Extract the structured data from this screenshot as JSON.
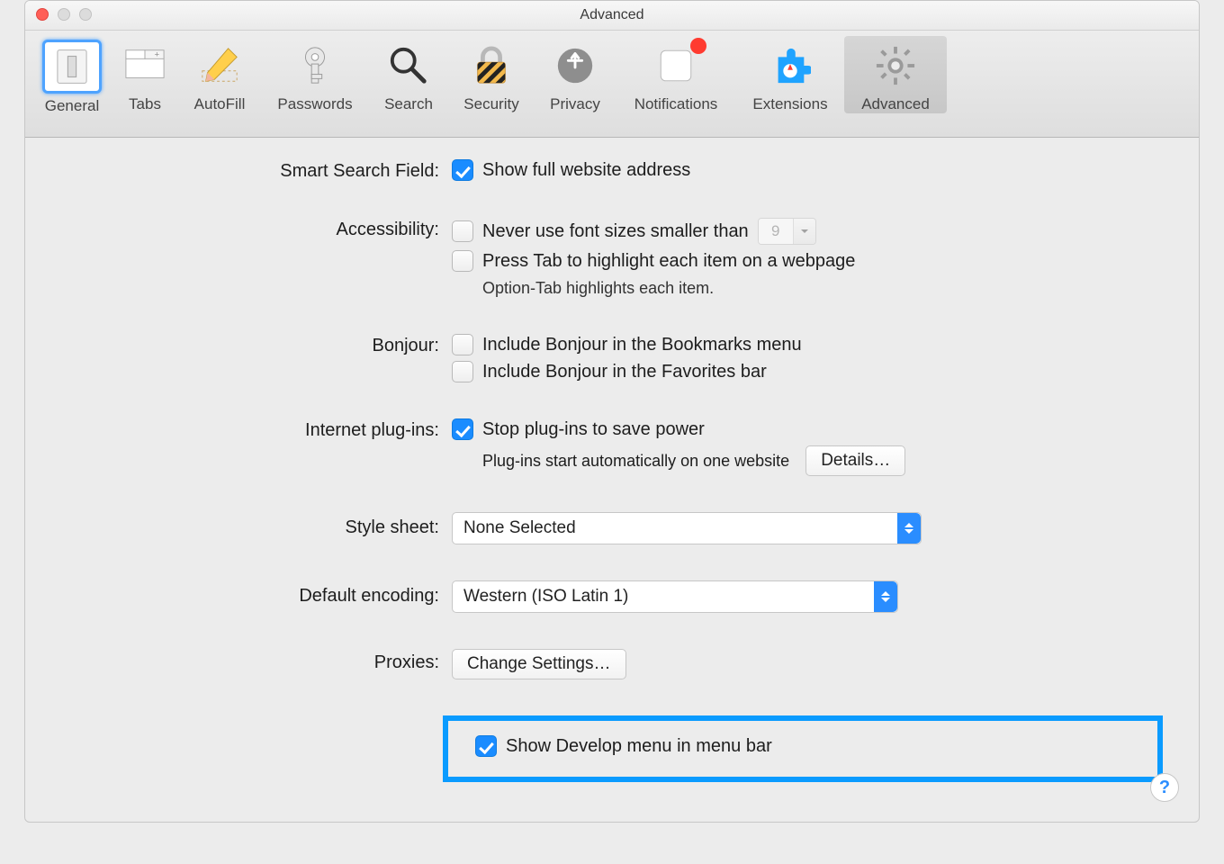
{
  "window": {
    "title": "Advanced"
  },
  "toolbar": {
    "items": [
      {
        "label": "General"
      },
      {
        "label": "Tabs"
      },
      {
        "label": "AutoFill"
      },
      {
        "label": "Passwords"
      },
      {
        "label": "Search"
      },
      {
        "label": "Security"
      },
      {
        "label": "Privacy"
      },
      {
        "label": "Notifications"
      },
      {
        "label": "Extensions"
      },
      {
        "label": "Advanced"
      }
    ]
  },
  "sections": {
    "smartSearch": {
      "label": "Smart Search Field:",
      "showFull": "Show full website address"
    },
    "accessibility": {
      "label": "Accessibility:",
      "neverSmaller": "Never use font sizes smaller than",
      "fontSize": "9",
      "pressTab": "Press Tab to highlight each item on a webpage",
      "hint": "Option-Tab highlights each item."
    },
    "bonjour": {
      "label": "Bonjour:",
      "bookmarks": "Include Bonjour in the Bookmarks menu",
      "favorites": "Include Bonjour in the Favorites bar"
    },
    "plugins": {
      "label": "Internet plug-ins:",
      "stop": "Stop plug-ins to save power",
      "hint": "Plug-ins start automatically on one website",
      "details": "Details…"
    },
    "stylesheet": {
      "label": "Style sheet:",
      "value": "None Selected"
    },
    "encoding": {
      "label": "Default encoding:",
      "value": "Western (ISO Latin 1)"
    },
    "proxies": {
      "label": "Proxies:",
      "button": "Change Settings…"
    },
    "develop": {
      "show": "Show Develop menu in menu bar"
    }
  },
  "help": "?"
}
